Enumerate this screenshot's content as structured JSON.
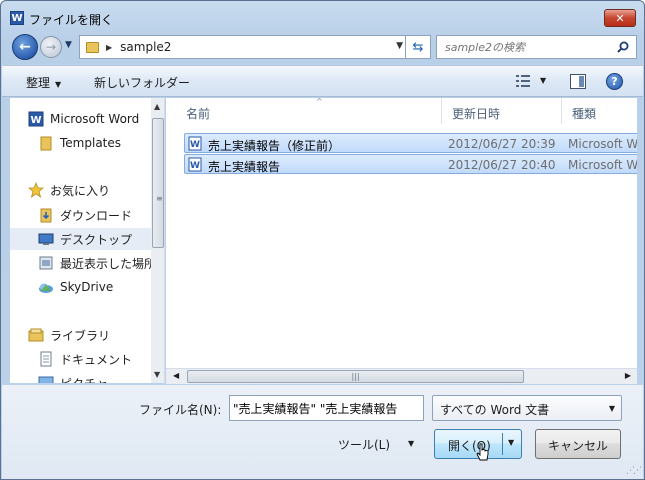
{
  "window": {
    "title": "ファイルを開く",
    "app_icon_letter": "W"
  },
  "navbar": {
    "address_path": "sample2",
    "search_placeholder": "sample2の検索"
  },
  "toolbar": {
    "organize_label": "整理",
    "new_folder_label": "新しいフォルダー"
  },
  "nav_pane": {
    "items": [
      {
        "label": "Microsoft Word",
        "icon": "word-icon"
      },
      {
        "label": "Templates",
        "icon": "folder-icon"
      },
      {
        "label": "お気に入り",
        "icon": "star-icon"
      },
      {
        "label": "ダウンロード",
        "icon": "download-folder-icon"
      },
      {
        "label": "デスクトップ",
        "icon": "desktop-icon"
      },
      {
        "label": "最近表示した場所",
        "icon": "recent-places-icon"
      },
      {
        "label": "SkyDrive",
        "icon": "skydrive-icon"
      },
      {
        "label": "ライブラリ",
        "icon": "library-icon"
      },
      {
        "label": "ドキュメント",
        "icon": "documents-icon"
      },
      {
        "label": "ピクチャ",
        "icon": "pictures-icon"
      }
    ]
  },
  "file_list": {
    "columns": [
      "名前",
      "更新日時",
      "種類"
    ],
    "rows": [
      {
        "name": "売上実績報告（修正前）",
        "modified": "2012/06/27 20:39",
        "type": "Microsoft Wo"
      },
      {
        "name": "売上実績報告",
        "modified": "2012/06/27 20:40",
        "type": "Microsoft Wo"
      }
    ]
  },
  "bottom": {
    "filename_label": "ファイル名(N):",
    "filename_value": "\"売上実績報告\" \"売上実績報告",
    "filter_value": "すべての Word 文書",
    "tools_label": "ツール(L)",
    "open_label": "開く(O)",
    "cancel_label": "キャンセル"
  },
  "colors": {
    "selection_fill": "#c1dbfc",
    "selection_border": "#84acdd",
    "close_button": "#c7452f"
  }
}
